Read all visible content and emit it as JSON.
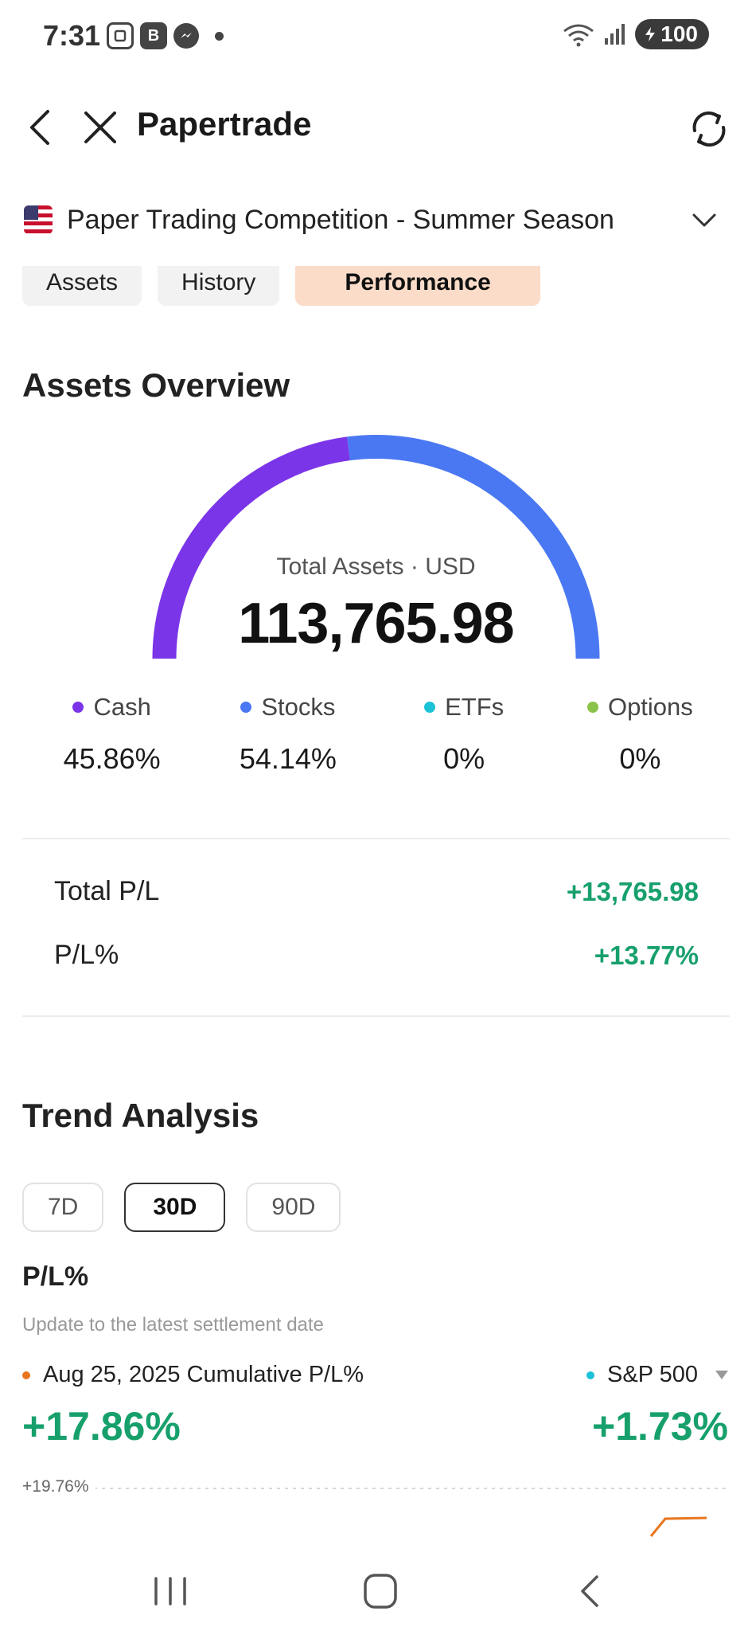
{
  "status_bar": {
    "time": "7:31",
    "notif_b": "B",
    "battery": "100",
    "icons": [
      "screenshot-icon",
      "b-app-icon",
      "messenger-icon",
      "dot-icon",
      "wifi-icon",
      "signal-icon",
      "battery-icon"
    ]
  },
  "header": {
    "title": "Papertrade"
  },
  "competition": {
    "label": "Paper Trading Competition - Summer Season"
  },
  "tabs": [
    {
      "label": "Assets",
      "active": false
    },
    {
      "label": "History",
      "active": false
    },
    {
      "label": "Performance",
      "active": true
    }
  ],
  "overview": {
    "title": "Assets Overview",
    "total_label": "Total Assets · USD",
    "total_value": "113,765.98",
    "allocation": [
      {
        "name": "Cash",
        "pct": "45.86%",
        "value": 45.86,
        "color": "#7b35e8"
      },
      {
        "name": "Stocks",
        "pct": "54.14%",
        "value": 54.14,
        "color": "#4a78f3"
      },
      {
        "name": "ETFs",
        "pct": "0%",
        "value": 0,
        "color": "#1cc2d6"
      },
      {
        "name": "Options",
        "pct": "0%",
        "value": 0,
        "color": "#8bc34a"
      }
    ],
    "total_pl_label": "Total P/L",
    "total_pl_value": "+13,765.98",
    "pl_pct_label": "P/L%",
    "pl_pct_value": "+13.77%"
  },
  "trend": {
    "title": "Trend Analysis",
    "periods": [
      {
        "label": "7D",
        "active": false
      },
      {
        "label": "30D",
        "active": true
      },
      {
        "label": "90D",
        "active": false
      }
    ],
    "subtitle": "P/L%",
    "note": "Update to the latest settlement date",
    "legend_left": "Aug 25, 2025 Cumulative P/L%",
    "legend_right": "S&P 500",
    "value_left": "+17.86%",
    "value_right": "+1.73%",
    "top_line_label": "+19.76%",
    "colors": {
      "portfolio": "#e8761e",
      "sp500": "#1cc2d6",
      "positive": "#17a06c"
    }
  }
}
